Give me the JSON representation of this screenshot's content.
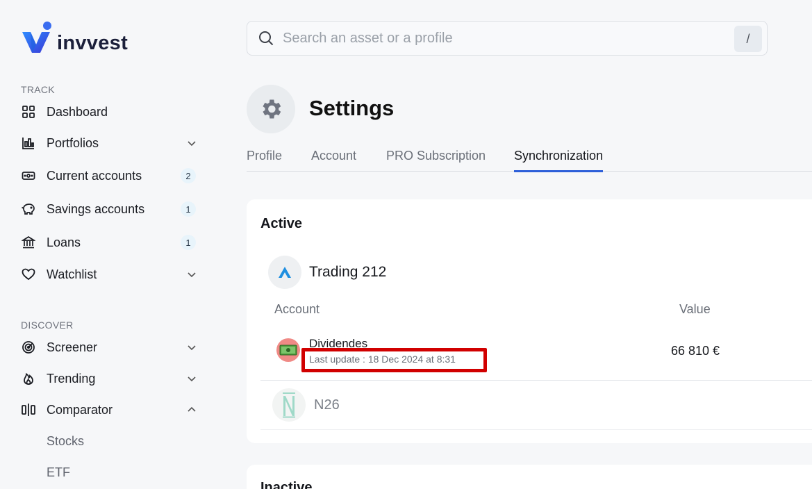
{
  "brand": {
    "name": "invvest"
  },
  "sidebar": {
    "track_label": "TRACK",
    "discover_label": "DISCOVER",
    "items": [
      {
        "label": "Dashboard",
        "icon": "grid-icon"
      },
      {
        "label": "Portfolios",
        "icon": "bar-chart-icon",
        "chevron": "down"
      },
      {
        "label": "Current accounts",
        "icon": "wallet-icon",
        "badge": "2"
      },
      {
        "label": "Savings accounts",
        "icon": "piggy-bank-icon",
        "badge": "1"
      },
      {
        "label": "Loans",
        "icon": "bank-icon",
        "badge": "1"
      },
      {
        "label": "Watchlist",
        "icon": "heart-icon",
        "chevron": "down"
      },
      {
        "label": "Screener",
        "icon": "radar-icon",
        "chevron": "down"
      },
      {
        "label": "Trending",
        "icon": "flame-icon",
        "chevron": "down"
      },
      {
        "label": "Comparator",
        "icon": "compare-icon",
        "chevron": "up"
      },
      {
        "label": "Stocks"
      },
      {
        "label": "ETF"
      }
    ]
  },
  "search": {
    "placeholder": "Search an asset or a profile",
    "value": "",
    "shortcut": "/"
  },
  "header": {
    "title": "Settings",
    "icon": "gear-icon"
  },
  "tabs": [
    {
      "label": "Profile"
    },
    {
      "label": "Account"
    },
    {
      "label": "PRO Subscription"
    },
    {
      "label": "Synchronization",
      "active": true
    }
  ],
  "active_section": {
    "title": "Active",
    "brokers": [
      {
        "name": "Trading 212",
        "columns": {
          "account": "Account",
          "value": "Value"
        },
        "accounts": [
          {
            "name": "Dividendes",
            "last_update": "Last update : 18 Dec 2024 at 8:31",
            "value": "66 810 €"
          }
        ]
      },
      {
        "name": "N26"
      }
    ]
  },
  "inactive_section": {
    "title": "Inactive"
  },
  "colors": {
    "accent": "#2d5fd9",
    "highlight": "#d10000",
    "logo_blue": "#2f7be8"
  }
}
